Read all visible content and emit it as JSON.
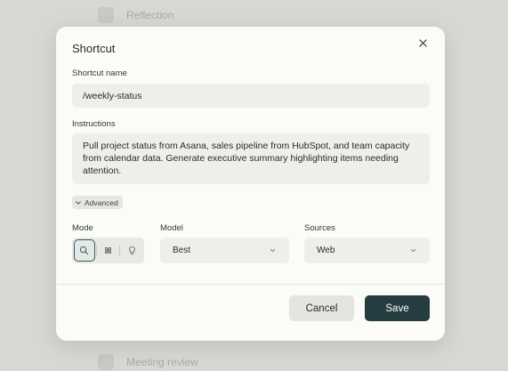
{
  "background": {
    "top_item": "Reflection",
    "bottom_item": "Meeting review"
  },
  "modal": {
    "title": "Shortcut",
    "close_icon": "close-icon",
    "shortcut_name": {
      "label": "Shortcut name",
      "value": "/weekly-status"
    },
    "instructions": {
      "label": "Instructions",
      "value": "Pull project status from Asana, sales pipeline from HubSpot, and team capacity from calendar data. Generate executive summary highlighting items needing attention."
    },
    "advanced": {
      "label": "Advanced",
      "icon": "chevron-down-icon"
    },
    "mode": {
      "label": "Mode",
      "options": [
        {
          "icon": "search-icon",
          "active": true
        },
        {
          "icon": "atom-icon",
          "active": false
        },
        {
          "icon": "lightbulb-icon",
          "active": false
        }
      ]
    },
    "model": {
      "label": "Model",
      "value": "Best"
    },
    "sources": {
      "label": "Sources",
      "value": "Web"
    },
    "buttons": {
      "cancel": "Cancel",
      "save": "Save"
    }
  },
  "colors": {
    "accent": "#253c40",
    "modal_bg": "#fbfbf8",
    "input_bg": "#efefea"
  }
}
